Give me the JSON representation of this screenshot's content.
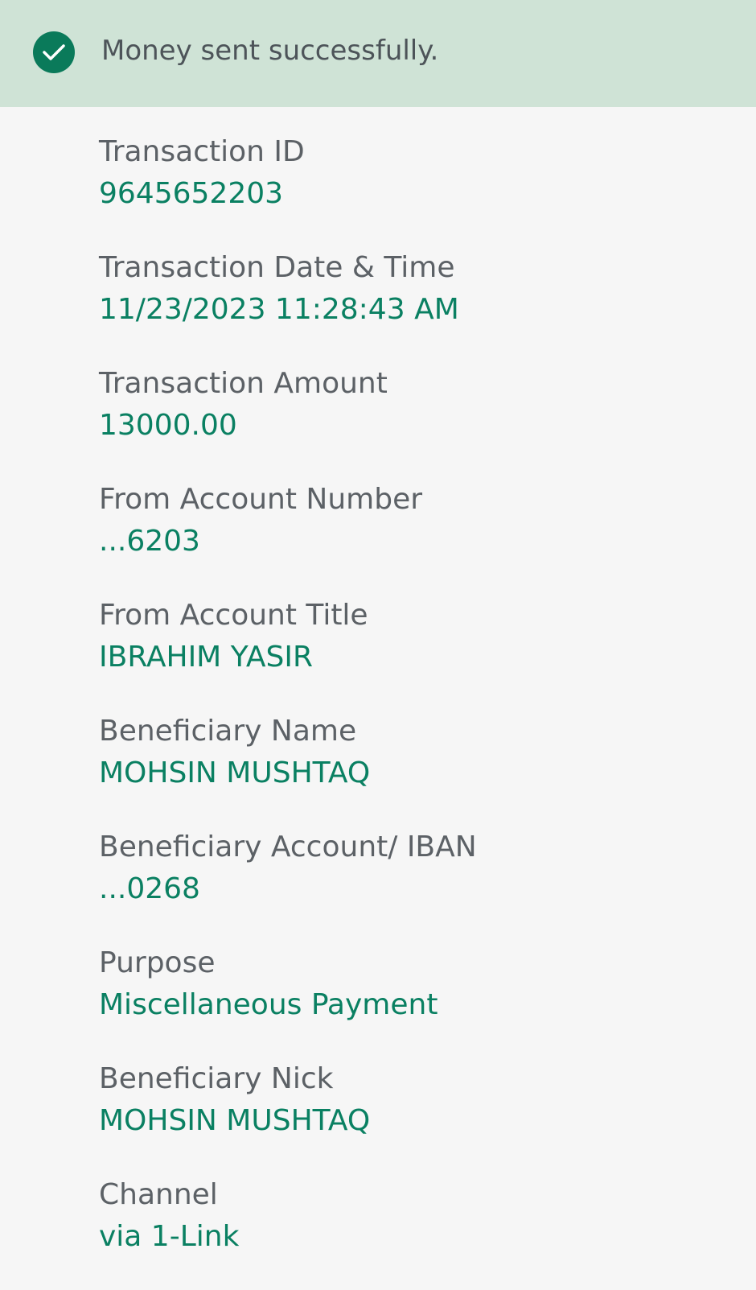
{
  "banner": {
    "message": "Money sent successfully.",
    "icon": "check-circle-icon",
    "background_color": "#cfe3d6",
    "icon_color": "#0a7a5a"
  },
  "colors": {
    "label": "#5c6166",
    "value": "#0a8062",
    "page_background": "#f6f6f6"
  },
  "details": [
    {
      "label": "Transaction ID",
      "value": "9645652203"
    },
    {
      "label": "Transaction Date & Time",
      "value": "11/23/2023 11:28:43 AM"
    },
    {
      "label": "Transaction Amount",
      "value": "13000.00"
    },
    {
      "label": "From Account Number",
      "value": "...6203"
    },
    {
      "label": "From Account Title",
      "value": "IBRAHIM YASIR"
    },
    {
      "label": "Beneficiary Name",
      "value": "MOHSIN MUSHTAQ"
    },
    {
      "label": "Beneficiary Account/ IBAN",
      "value": "...0268"
    },
    {
      "label": "Purpose",
      "value": "Miscellaneous Payment"
    },
    {
      "label": "Beneficiary Nick",
      "value": "MOHSIN MUSHTAQ"
    },
    {
      "label": "Channel",
      "value": "via 1-Link"
    }
  ]
}
